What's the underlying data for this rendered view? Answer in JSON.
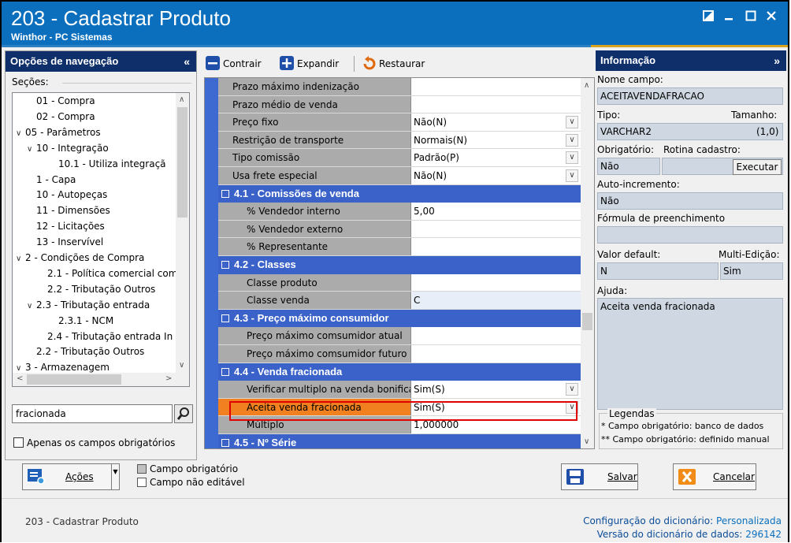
{
  "window": {
    "title": "203 - Cadastrar  Produto",
    "subtitle": "Winthor - PC Sistemas",
    "controls": [
      "restore-icon",
      "minimize-icon",
      "maximize-icon",
      "close-icon"
    ]
  },
  "nav": {
    "header": "Opções de navegação",
    "collapse_glyph": "«",
    "sections_label": "Seções:",
    "tree": [
      {
        "label": "01 - Compra",
        "indent": 1,
        "exp": ""
      },
      {
        "label": "02 - Compra",
        "indent": 1,
        "exp": ""
      },
      {
        "label": "05 - Parâmetros",
        "indent": 0,
        "exp": "∨"
      },
      {
        "label": "10 - Integração",
        "indent": 1,
        "exp": "∨"
      },
      {
        "label": "10.1 - Utiliza integraçã",
        "indent": 3,
        "exp": ""
      },
      {
        "label": "1 - Capa",
        "indent": 1,
        "exp": ""
      },
      {
        "label": "10 - Autopeças",
        "indent": 1,
        "exp": ""
      },
      {
        "label": "11 - Dimensões",
        "indent": 1,
        "exp": ""
      },
      {
        "label": "12 - Licitações",
        "indent": 1,
        "exp": ""
      },
      {
        "label": "13 - Inservível",
        "indent": 1,
        "exp": ""
      },
      {
        "label": "2 - Condições de Compra",
        "indent": 0,
        "exp": "∨"
      },
      {
        "label": "2.1 - Política comercial com",
        "indent": 2,
        "exp": ""
      },
      {
        "label": "2.2 - Tributação Outros",
        "indent": 2,
        "exp": ""
      },
      {
        "label": "2.3 - Tributação entrada",
        "indent": 1,
        "exp": "∨"
      },
      {
        "label": "2.3.1 - NCM",
        "indent": 3,
        "exp": ""
      },
      {
        "label": "2.4 - Tributação entrada In",
        "indent": 2,
        "exp": ""
      },
      {
        "label": "2.2 - Tributação Outros",
        "indent": 1,
        "exp": ""
      },
      {
        "label": "3 - Armazenagem",
        "indent": 0,
        "exp": "∨"
      }
    ],
    "search_value": "fracionada",
    "only_required_label": "Apenas os campos obrigatórios"
  },
  "toolbar": {
    "collapse": "Contrair",
    "expand": "Expandir",
    "restore": "Restaurar"
  },
  "grid": {
    "rows": [
      {
        "kind": "row",
        "label": "Prazo máximo indenização",
        "value": "",
        "dd": false
      },
      {
        "kind": "row",
        "label": "Prazo médio de venda",
        "value": "",
        "dd": false
      },
      {
        "kind": "row",
        "label": "Preço fixo",
        "value": "Não(N)",
        "dd": true
      },
      {
        "kind": "row",
        "label": "Restrição de transporte",
        "value": "Normais(N)",
        "dd": true
      },
      {
        "kind": "row",
        "label": "Tipo comissão",
        "value": "Padrão(P)",
        "dd": true
      },
      {
        "kind": "row",
        "label": "Usa frete especial",
        "value": "Não(N)",
        "dd": true
      },
      {
        "kind": "cat",
        "label": "4.1 - Comissões de venda"
      },
      {
        "kind": "sub",
        "label": "% Vendedor interno",
        "value": "5,00",
        "dd": false
      },
      {
        "kind": "sub",
        "label": "% Vendedor externo",
        "value": "",
        "dd": false
      },
      {
        "kind": "sub",
        "label": "% Representante",
        "value": "",
        "dd": false
      },
      {
        "kind": "cat",
        "label": "4.2 - Classes"
      },
      {
        "kind": "sub",
        "label": "Classe produto",
        "value": "",
        "dd": false
      },
      {
        "kind": "sub",
        "label": "Classe venda",
        "value": "C",
        "dd": false,
        "shade": true
      },
      {
        "kind": "cat",
        "label": "4.3 - Preço máximo consumidor"
      },
      {
        "kind": "sub",
        "label": "Preço máximo comsumidor atual",
        "value": "",
        "dd": false
      },
      {
        "kind": "sub",
        "label": "Preço máximo comsumidor futuro",
        "value": "",
        "dd": false
      },
      {
        "kind": "cat",
        "label": "4.4 - Venda fracionada"
      },
      {
        "kind": "sub",
        "label": "Verificar multiplo na venda bonifica",
        "value": "Sim(S)",
        "dd": true
      },
      {
        "kind": "sub",
        "label": "Aceita venda fracionada",
        "value": "Sim(S)",
        "dd": true,
        "selected": true
      },
      {
        "kind": "sub",
        "label": "Múltiplo",
        "value": "1,000000",
        "dd": false
      },
      {
        "kind": "cat",
        "label": "4.5 - Nº Série"
      }
    ]
  },
  "info": {
    "header": "Informação",
    "collapse_glyph": "»",
    "field_name_label": "Nome campo:",
    "field_name": "ACEITAVENDAFRACAO",
    "type_label": "Tipo:",
    "size_label": "Tamanho:",
    "type": "VARCHAR2",
    "size": "(1,0)",
    "required_label": "Obrigatório:",
    "routine_label": "Rotina cadastro:",
    "required": "Não",
    "execute_label": "Executar",
    "autoinc_label": "Auto-incremento:",
    "autoinc": "Não",
    "formula_label": "Fórmula de preenchimento",
    "formula": "",
    "default_label": "Valor default:",
    "multi_label": "Multi-Edição:",
    "default": "N",
    "multi": "Sim",
    "help_label": "Ajuda:",
    "help": "Aceita venda fracionada",
    "legend_title": "Legendas",
    "legend_1": "* Campo obrigatório: banco de dados",
    "legend_2": "** Campo obrigatório: definido manual"
  },
  "bottom": {
    "actions_label": "Ações",
    "legend_required": "Campo obrigatório",
    "legend_readonly": "Campo não editável",
    "save_label": "Salvar",
    "cancel_label": "Cancelar"
  },
  "status": {
    "left": "203 - Cadastrar  Produto",
    "config_label": "Configuração do dicionário:",
    "config_value": "Personalizada",
    "version_label": "Versão do dicionário de dados:",
    "version_value": "296142"
  },
  "colors": {
    "titlebar": "#0b6fbd",
    "panel_header": "#0f2f6b",
    "category": "#3b62c8",
    "selected_label": "#f08020",
    "highlight_border": "#e00000"
  }
}
